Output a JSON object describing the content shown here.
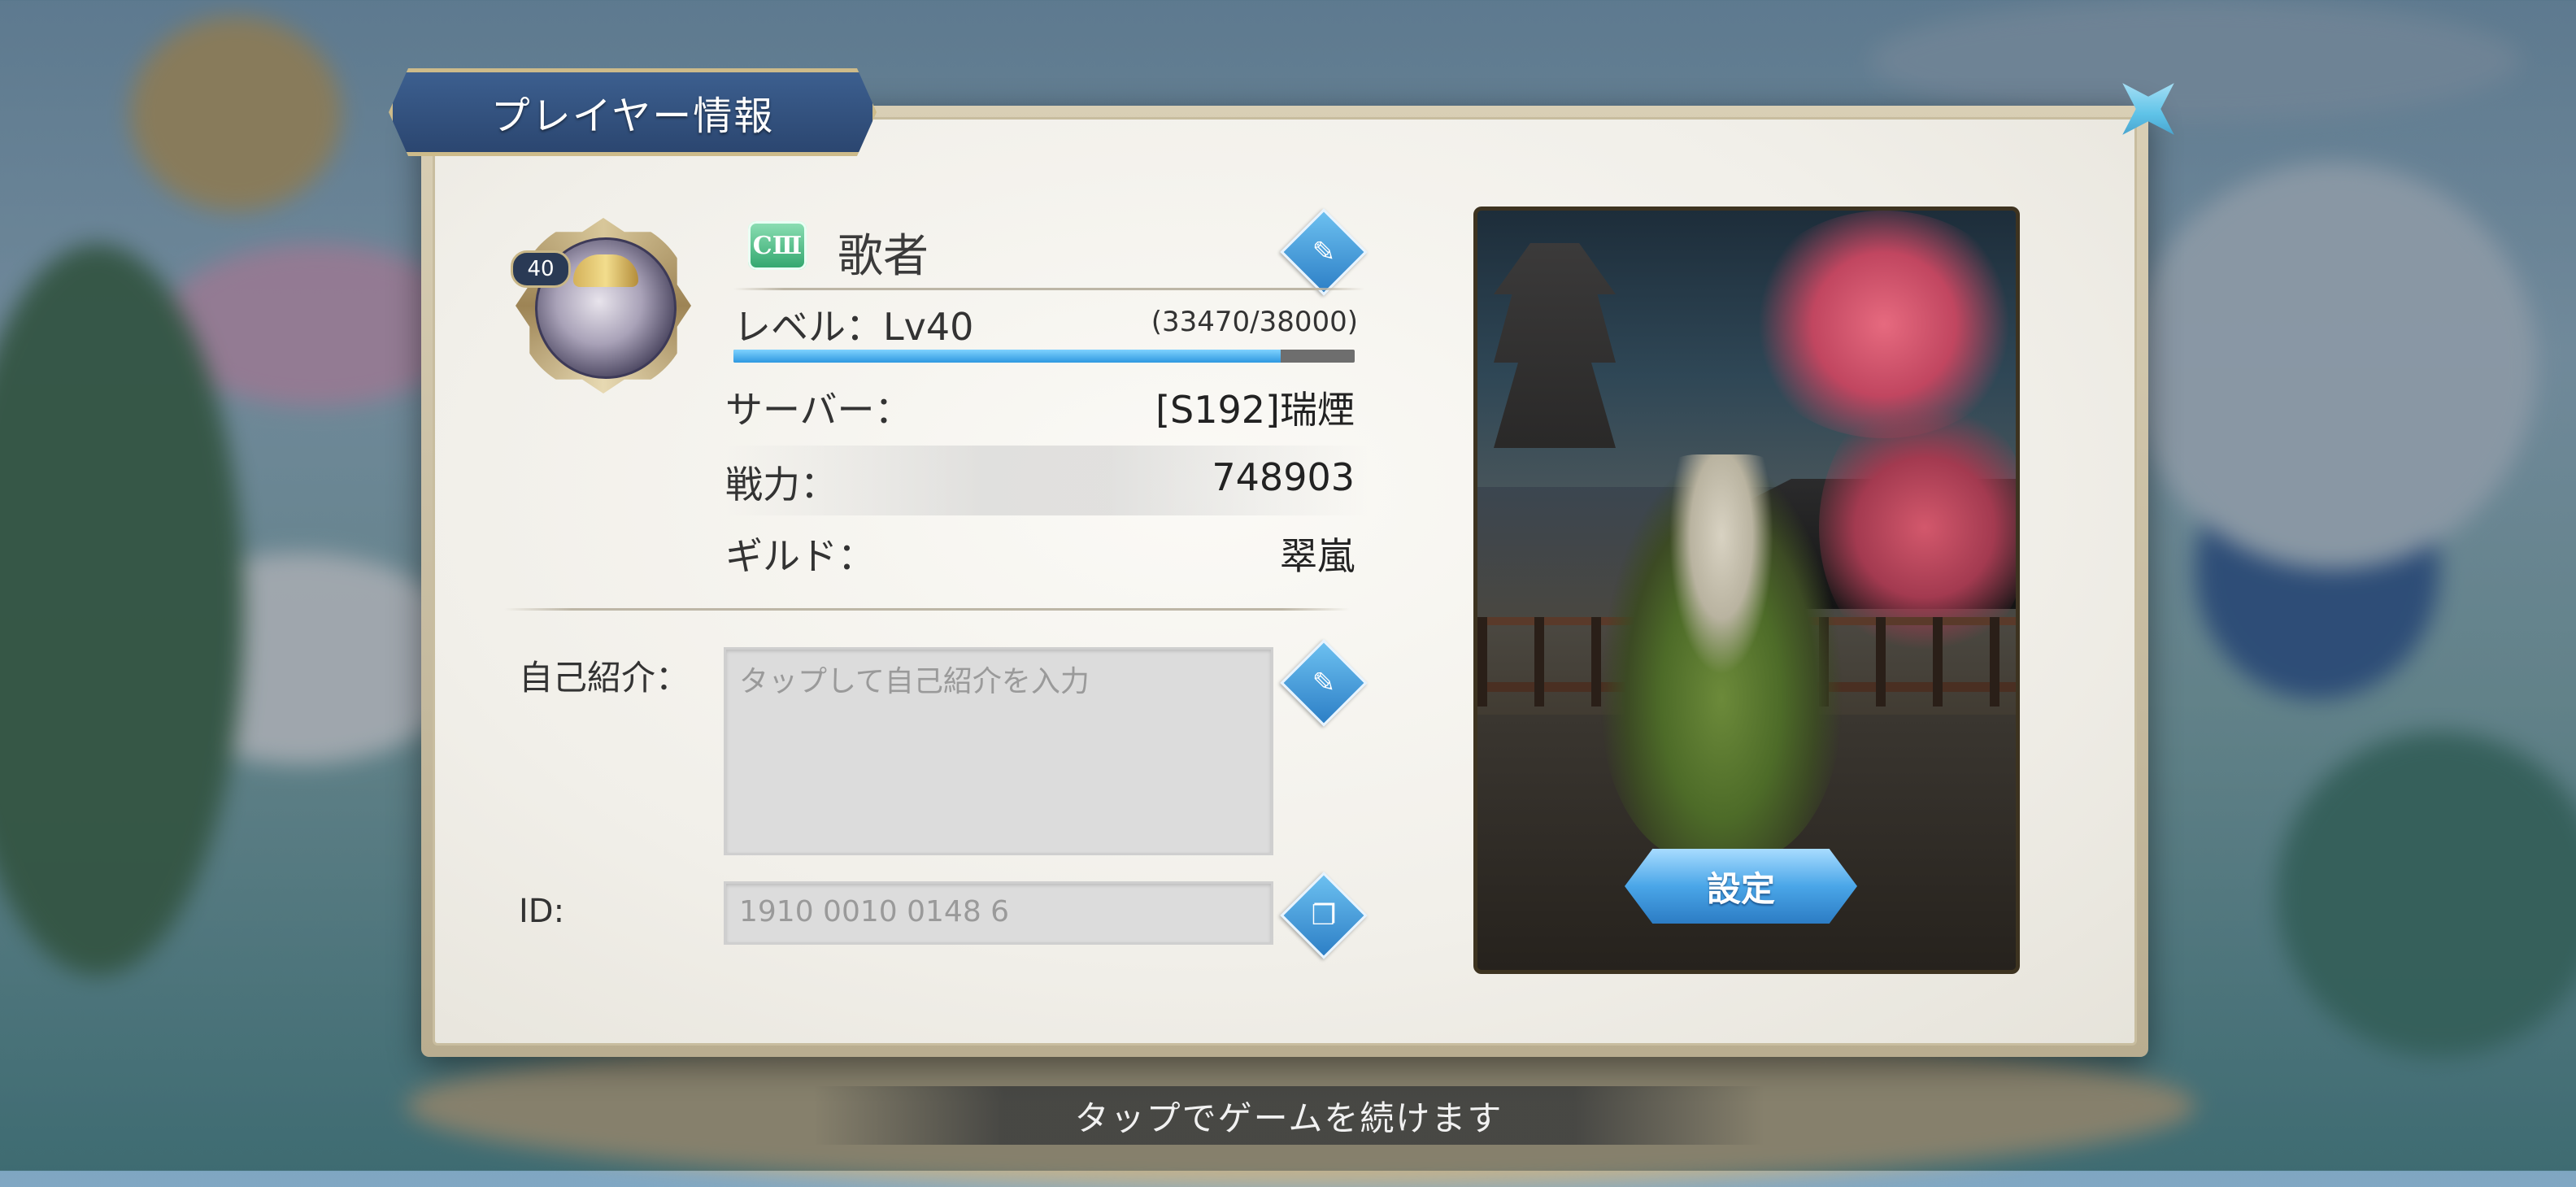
{
  "dialog": {
    "title": "プレイヤー情報"
  },
  "player": {
    "avatar_level": "40",
    "class_badge": "CⅢ",
    "name": "歌者",
    "level_label": "レベル：Lv40",
    "exp_text": "(33470/38000)",
    "exp_fraction": 0.881,
    "server_label": "サーバー：",
    "server_value": "[S192]瑞煙",
    "power_label": "戦力：",
    "power_value": "748903",
    "guild_label": "ギルド：",
    "guild_value": "翠嵐"
  },
  "intro": {
    "label": "自己紹介：",
    "placeholder": "タップして自己紹介を入力"
  },
  "id": {
    "label": "ID:",
    "value": "1910 0010 0148 6"
  },
  "card": {
    "set_button": "設定"
  },
  "footer": {
    "continue_text": "タップでゲームを続けます"
  },
  "icons": {
    "close": "close-star-icon",
    "edit": "pencil-icon",
    "copy": "copy-icon"
  },
  "colors": {
    "accent_blue": "#2f98e0",
    "title_banner": "#2b4670",
    "badge_green": "#2fa56c"
  }
}
